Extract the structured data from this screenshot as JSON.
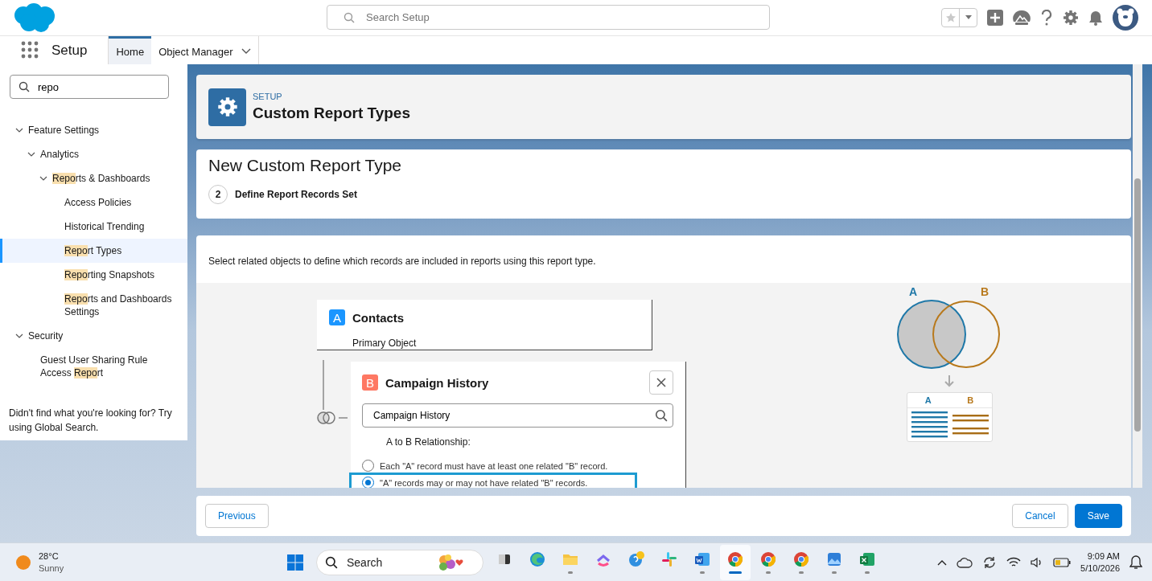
{
  "search": {
    "placeholder": "Search Setup"
  },
  "nav": {
    "app_title": "Setup",
    "tabs": [
      {
        "label": "Home",
        "selected": true,
        "dropdown": false
      },
      {
        "label": "Object Manager",
        "selected": false,
        "dropdown": true
      }
    ]
  },
  "sidebar": {
    "search": {
      "value": "repo"
    },
    "tree": [
      {
        "label": "Feature Settings",
        "expanded": true,
        "selected": false,
        "children": [
          {
            "label": "Analytics",
            "expanded": true,
            "selected": false,
            "children": [
              {
                "segments": [
                  {
                    "text": "Repo",
                    "matched": true
                  },
                  {
                    "text": "rts & Dashboards",
                    "matched": false
                  }
                ],
                "expanded": true,
                "selected": false,
                "children": [
                  {
                    "label": "Access Policies",
                    "selected": false
                  },
                  {
                    "label": "Historical Trending",
                    "selected": false
                  },
                  {
                    "segments": [
                      {
                        "text": "Repo",
                        "matched": true
                      },
                      {
                        "text": "rt Types",
                        "matched": false
                      }
                    ],
                    "selected": true
                  },
                  {
                    "segments": [
                      {
                        "text": "Repo",
                        "matched": true
                      },
                      {
                        "text": "rting Snapshots",
                        "matched": false
                      }
                    ],
                    "selected": false
                  },
                  {
                    "segments": [
                      {
                        "text": "Repo",
                        "matched": true
                      },
                      {
                        "text": "rts and Dashboards Settings",
                        "matched": false
                      }
                    ],
                    "selected": false
                  }
                ]
              }
            ]
          }
        ]
      },
      {
        "label": "Security",
        "expanded": true,
        "selected": false,
        "children": [
          {
            "segments": [
              {
                "text": "Guest User Sharing Rule Access ",
                "matched": false
              },
              {
                "text": "Repo",
                "matched": true
              },
              {
                "text": "rt",
                "matched": false
              }
            ],
            "selected": false
          }
        ]
      }
    ],
    "hint": "Didn't find what you're looking for? Try using Global Search."
  },
  "page_header": {
    "breadcrumb": "SETUP",
    "title": "Custom Report Types"
  },
  "wizard": {
    "title": "New Custom Report Type",
    "step_number": "2",
    "step_title": "Define Report Records Set"
  },
  "instructions": "Select related objects to define which records are included in reports using this report type.",
  "primary_object": {
    "badge": "A",
    "name": "Contacts",
    "caption": "Primary Object"
  },
  "related_object": {
    "badge": "B",
    "name": "Campaign History",
    "search_value": "Campaign History",
    "relationship_label": "A to B Relationship:",
    "options": [
      {
        "label": "Each \"A\" record must have at least one related \"B\" record.",
        "selected": false
      },
      {
        "label": "\"A\" records may or may not have related \"B\" records.",
        "selected": true
      }
    ]
  },
  "diagram": {
    "venn_labels": [
      "A",
      "B"
    ],
    "table_headers": [
      "A",
      "B"
    ]
  },
  "footer": {
    "left_buttons": [
      {
        "label": "Previous",
        "kind": "neutral"
      }
    ],
    "right_buttons": [
      {
        "label": "Cancel",
        "kind": "neutral"
      },
      {
        "label": "Save",
        "kind": "brand"
      }
    ]
  },
  "taskbar": {
    "weather": {
      "temperature": "28°C",
      "condition": "Sunny"
    },
    "search_placeholder": "Search",
    "apps": [
      {
        "kind": "taskview",
        "running": false,
        "active": false
      },
      {
        "kind": "edge",
        "running": false,
        "active": false
      },
      {
        "kind": "folder",
        "running": true,
        "active": false
      },
      {
        "kind": "clickup",
        "running": false,
        "active": false
      },
      {
        "kind": "chat",
        "running": false,
        "active": false
      },
      {
        "kind": "slack",
        "running": false,
        "active": false
      },
      {
        "kind": "word",
        "running": true,
        "active": false
      },
      {
        "kind": "chrome",
        "running": true,
        "active": true
      },
      {
        "kind": "chrome",
        "running": true,
        "active": false
      },
      {
        "kind": "chrome",
        "running": true,
        "active": false
      },
      {
        "kind": "photos",
        "running": true,
        "active": false
      },
      {
        "kind": "excel",
        "running": true,
        "active": false
      }
    ],
    "time": "9:09 AM",
    "date": "5/10/2026"
  }
}
